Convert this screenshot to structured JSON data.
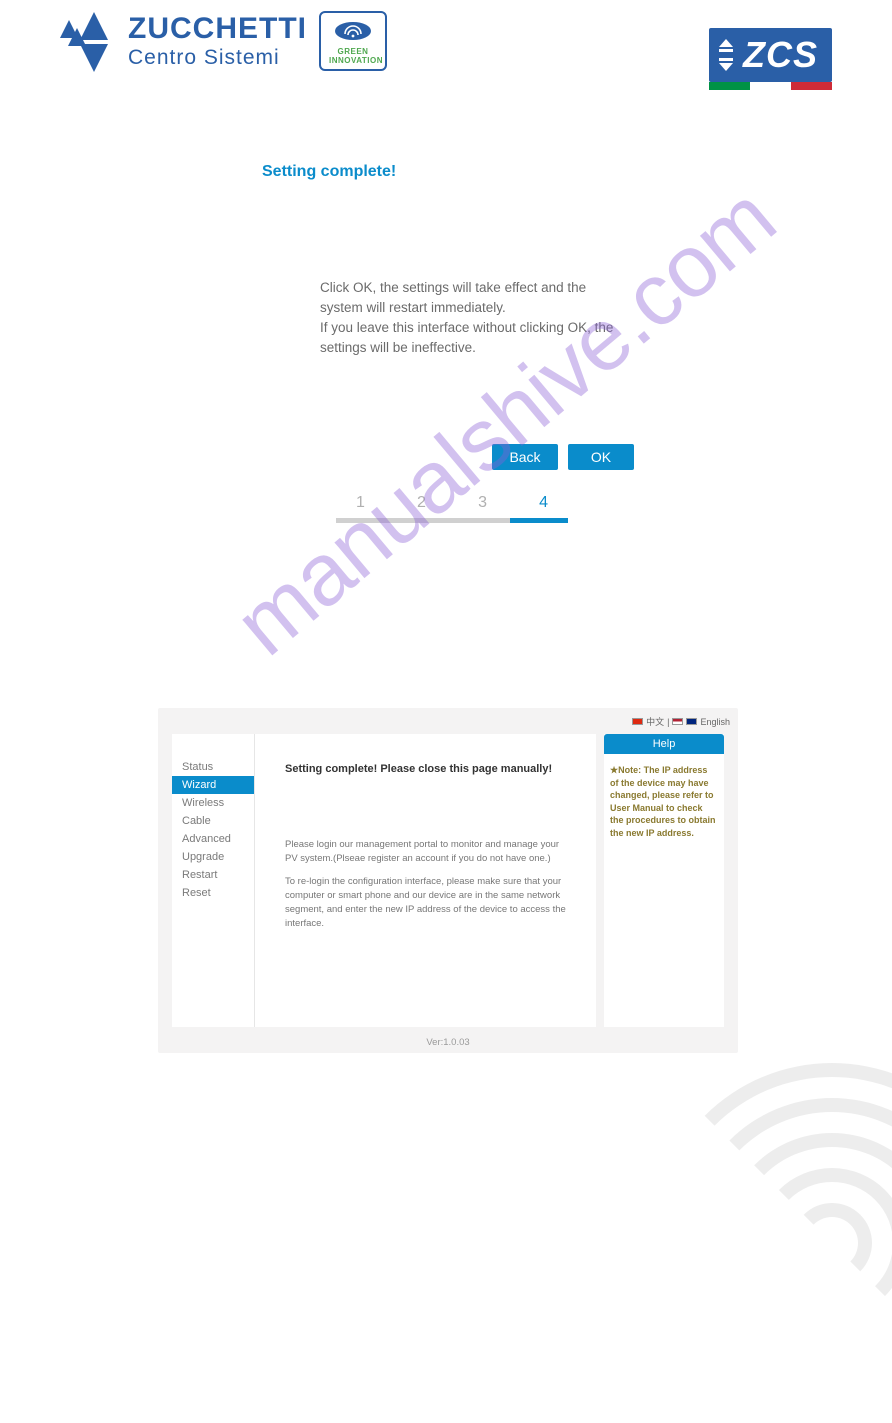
{
  "header": {
    "brand_line1": "ZUCCHETTI",
    "brand_line2": "Centro Sistemi",
    "badge_line1": "GREEN",
    "badge_line2": "INNOVATION",
    "zcs_label": "ZCS"
  },
  "wizard": {
    "title": "Setting complete!",
    "msg1": "Click OK, the settings will take effect and the system will restart immediately.",
    "msg2": "If you leave this interface without clicking OK, the settings will be ineffective.",
    "back_label": "Back",
    "ok_label": "OK",
    "steps": {
      "s1": "1",
      "s2": "2",
      "s3": "3",
      "s4": "4"
    }
  },
  "panel": {
    "lang_cn": "中文",
    "lang_sep": "|",
    "lang_en": "English",
    "nav": {
      "status": "Status",
      "wizard": "Wizard",
      "wireless": "Wireless",
      "cable": "Cable",
      "advanced": "Advanced",
      "upgrade": "Upgrade",
      "restart": "Restart",
      "reset": "Reset"
    },
    "center": {
      "title": "Setting complete! Please close this page manually!",
      "p1": "Please login our management portal to monitor and manage your PV system.(Plseae register an account if you do not have one.)",
      "p2": "To re-login the configuration interface, please make sure that your computer or smart phone and our device are in the same network segment, and enter the new IP address of the device to access the interface."
    },
    "help": {
      "title": "Help",
      "note": "★Note: The IP address of the device may have changed, please refer to User Manual to check the procedures to obtain the new IP address."
    },
    "version": "Ver:1.0.03"
  },
  "watermark": "manualshive.com"
}
